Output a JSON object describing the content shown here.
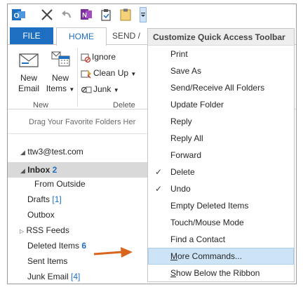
{
  "tabs": {
    "file": "FILE",
    "home": "HOME",
    "send": "SEND /"
  },
  "ribbon": {
    "new_email": [
      "New",
      "Email"
    ],
    "new_items": [
      "New",
      "Items"
    ],
    "new_group": "New",
    "ignore": "Ignore",
    "cleanup": "Clean Up",
    "junk": "Junk",
    "delete_group": "Delete"
  },
  "folders": {
    "favorites_hint": "Drag Your Favorite Folders Her",
    "account": "ttw3@test.com",
    "items": [
      {
        "name": "Inbox",
        "count": "2"
      },
      {
        "name": "From Outside"
      },
      {
        "name": "Drafts",
        "count": "[1]"
      },
      {
        "name": "Outbox"
      },
      {
        "name": "RSS Feeds"
      },
      {
        "name": "Deleted Items",
        "count": "6"
      },
      {
        "name": "Sent Items"
      },
      {
        "name": "Junk Email",
        "count": "[4]"
      }
    ]
  },
  "menu": {
    "title": "Customize Quick Access Toolbar",
    "items": [
      {
        "label": "Print",
        "checked": false
      },
      {
        "label": "Save As",
        "checked": false
      },
      {
        "label": "Send/Receive All Folders",
        "checked": false
      },
      {
        "label": "Update Folder",
        "checked": false
      },
      {
        "label": "Reply",
        "checked": false
      },
      {
        "label": "Reply All",
        "checked": false
      },
      {
        "label": "Forward",
        "checked": false
      },
      {
        "label": "Delete",
        "checked": true
      },
      {
        "label": "Undo",
        "checked": true
      },
      {
        "label": "Empty Deleted Items",
        "checked": false
      },
      {
        "label": "Touch/Mouse Mode",
        "checked": false
      },
      {
        "label": "Find a Contact",
        "checked": false
      },
      {
        "label_underline": "M",
        "label_rest": "ore Commands...",
        "highlighted": true
      },
      {
        "label_underline": "S",
        "label_rest": "how Below the Ribbon"
      }
    ],
    "check_glyph": "✓"
  },
  "colors": {
    "accent": "#1e6fc1",
    "highlight": "#cde4f7",
    "arrow": "#d9651e"
  },
  "icons": [
    "outlook-icon",
    "close-icon",
    "undo-icon",
    "onenote-icon",
    "clipboard-icon",
    "paste-icon",
    "customize-dropdown-icon",
    "new-email-icon",
    "new-items-icon",
    "ignore-icon",
    "cleanup-icon",
    "junk-icon",
    "expand-icon",
    "pointer-arrow-icon"
  ]
}
